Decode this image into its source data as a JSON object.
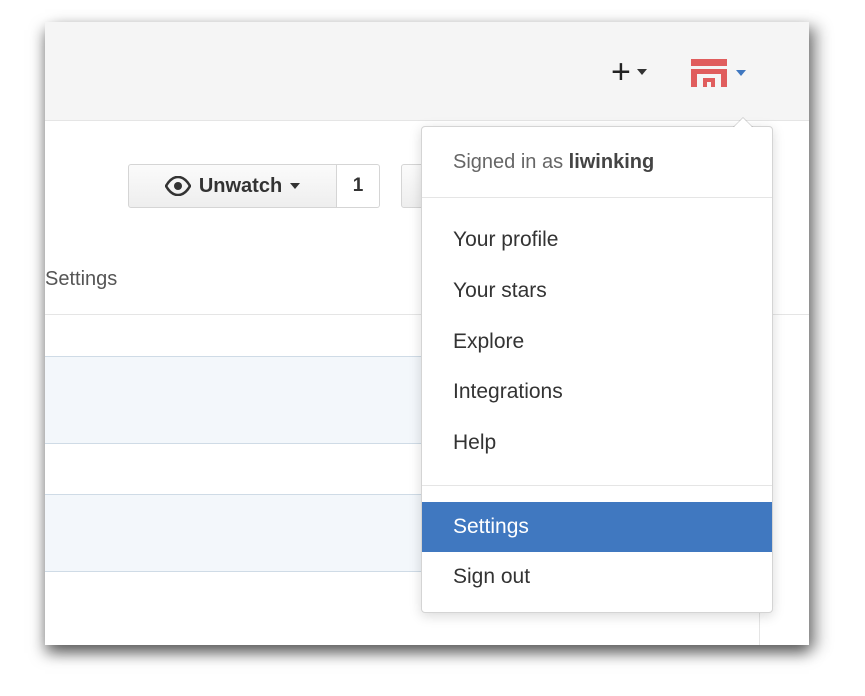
{
  "header": {
    "new_button": {
      "symbol": "+",
      "icon": "plus-icon"
    },
    "avatar": {
      "icon": "user-avatar-icon",
      "color": "#e05d5d"
    }
  },
  "repo_actions": {
    "watch_label": "Unwatch",
    "watch_count": "1"
  },
  "tabs": {
    "settings_label": "Settings"
  },
  "dropdown": {
    "signed_in_prefix": "Signed in as",
    "username": "liwinking",
    "items": [
      {
        "label": "Your profile"
      },
      {
        "label": "Your stars"
      },
      {
        "label": "Explore"
      },
      {
        "label": "Integrations"
      },
      {
        "label": "Help"
      }
    ],
    "footer_items": [
      {
        "label": "Settings",
        "active": true
      },
      {
        "label": "Sign out",
        "active": false
      }
    ]
  },
  "colors": {
    "accent": "#4078c0",
    "header_bg": "#f5f5f5",
    "row_highlight": "#f3f7fb"
  }
}
